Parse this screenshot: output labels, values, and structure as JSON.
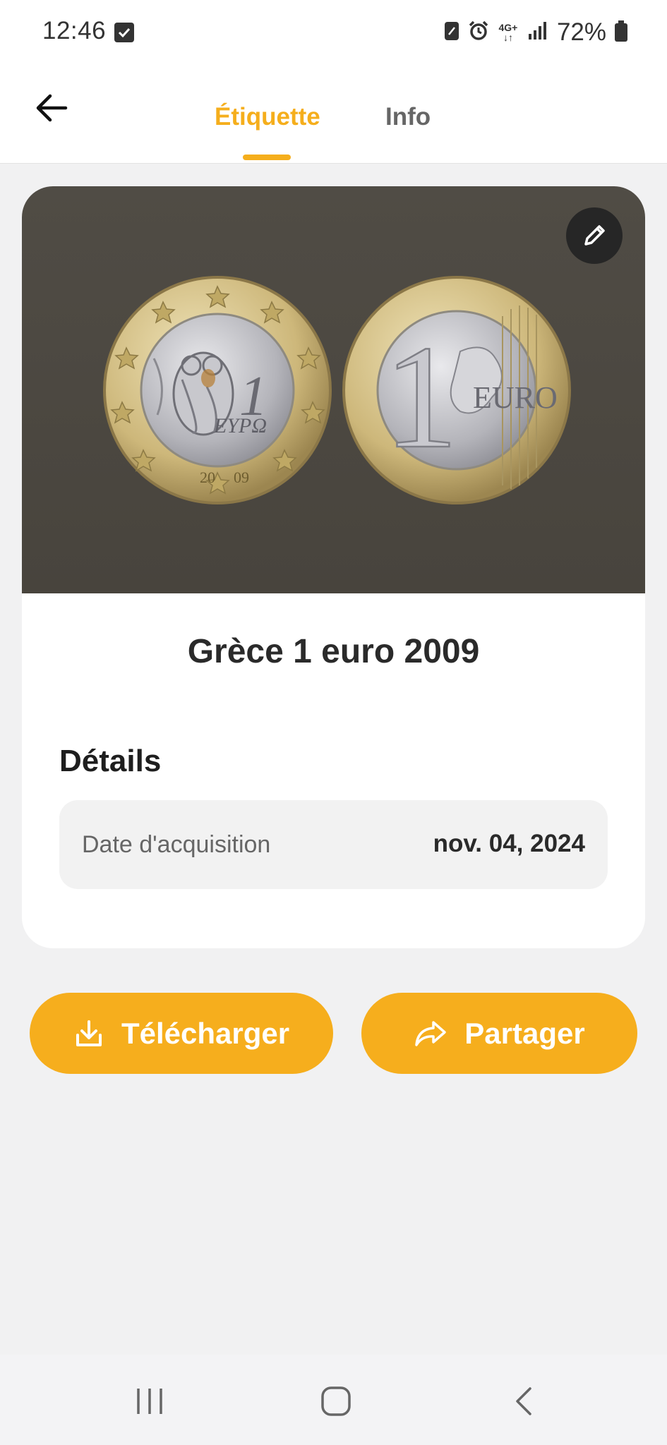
{
  "status_bar": {
    "time": "12:46",
    "battery_percent": "72%",
    "network_label": "4G+"
  },
  "header": {
    "tabs": [
      {
        "label": "Étiquette",
        "active": true
      },
      {
        "label": "Info",
        "active": false
      }
    ]
  },
  "coin": {
    "title": "Grèce 1 euro 2009",
    "obverse_text": "ΕΥΡΩ",
    "obverse_year_left": "20",
    "obverse_year_right": "09",
    "reverse_text": "EURO",
    "denomination": "1"
  },
  "details": {
    "heading": "Détails",
    "rows": [
      {
        "label": "Date d'acquisition",
        "value": "nov. 04, 2024"
      }
    ]
  },
  "actions": {
    "download_label": "Télécharger",
    "share_label": "Partager"
  },
  "colors": {
    "accent": "#f6ae1d",
    "photo_background": "#4c4841",
    "card_background": "#ffffff",
    "page_background": "#f1f1f2"
  },
  "icons": [
    "check-square-icon",
    "nfc-icon",
    "alarm-icon",
    "signal-icon",
    "battery-icon",
    "back-arrow-icon",
    "pencil-icon",
    "download-icon",
    "share-icon",
    "recent-apps-icon",
    "home-icon",
    "nav-back-icon"
  ]
}
